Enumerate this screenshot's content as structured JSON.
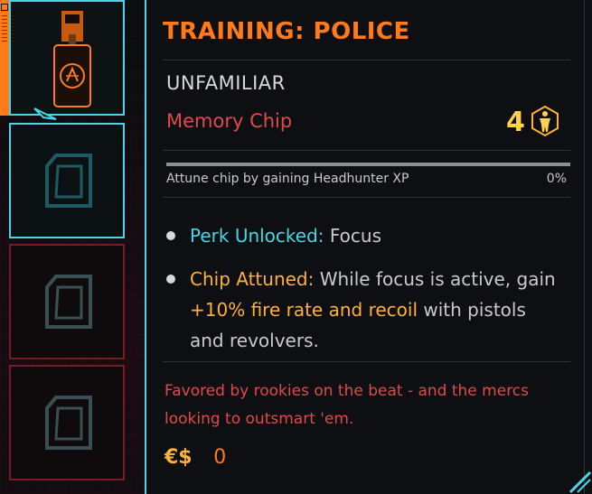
{
  "item": {
    "title": "TRAINING: POLICE",
    "rarity": "UNFAMILIAR",
    "type": "Memory Chip",
    "level": "4",
    "attune_text": "Attune chip by gaining Headhunter XP",
    "attune_percent": "0%",
    "attune_progress": 0,
    "perk_label": "Perk Unlocked:",
    "perk_value": "Focus",
    "chip_label": "Chip Attuned:",
    "chip_text_1": "While focus is active, gain",
    "chip_highlight": "+10% fire rate and recoil",
    "chip_text_2": "with pistols and revolvers.",
    "description": "Favored by rookies on the beat - and the mercs looking to outsmart 'em.",
    "currency_symbol": "€$",
    "price": "0"
  },
  "colors": {
    "accent_cyan": "#46d6e6",
    "title_orange": "#ff7a1a",
    "rarity_red": "#e04a4a",
    "level_yellow": "#ffd24a",
    "highlight_orange": "#ffb13a"
  },
  "icons": {
    "level_icon": "attribute-body-icon",
    "slot_icon": "sd-card-icon",
    "chip_icon": "memory-chip-icon"
  }
}
